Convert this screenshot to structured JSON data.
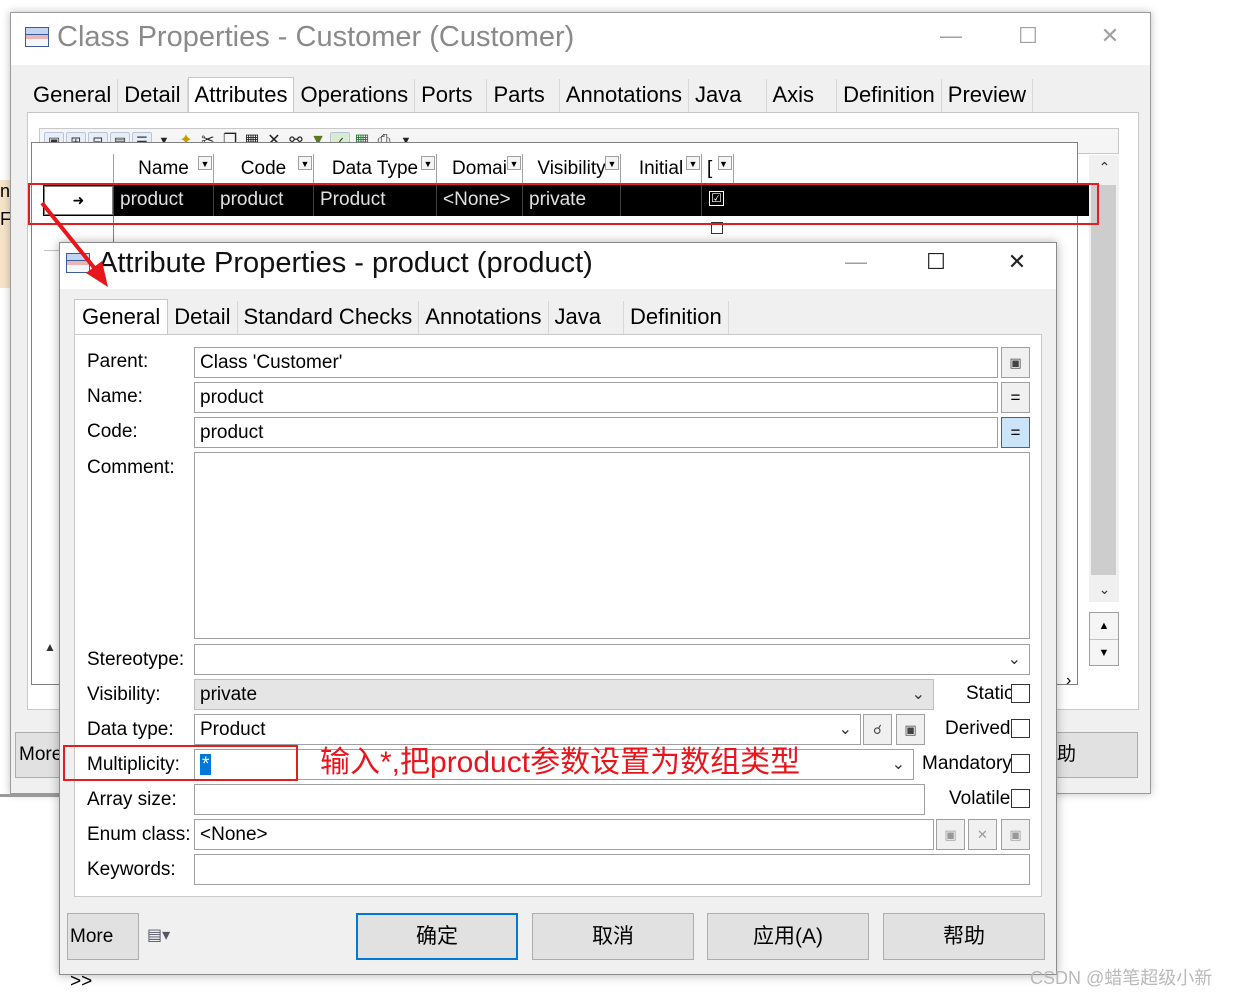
{
  "class_window": {
    "title": "Class Properties - Customer (Customer)",
    "tabs": [
      "General",
      "Detail",
      "Attributes",
      "Operations",
      "Ports",
      "Parts",
      "Annotations",
      "Java",
      "Axis",
      "Definition",
      "Preview"
    ],
    "active_tab": "Attributes",
    "grid": {
      "columns": [
        "Name",
        "Code",
        "Data Type",
        "Domai",
        "Visibility",
        "Initial",
        "["
      ],
      "row": {
        "marker": "➜",
        "name": "product",
        "code": "product",
        "data_type": "Product",
        "domain": "<None>",
        "visibility": "private",
        "initial": "",
        "checked": "☑"
      }
    },
    "more_button": "More",
    "help_button": "助"
  },
  "left_fragment": {
    "text1": "ne",
    "text2": "F"
  },
  "attr_dialog": {
    "title": "Attribute Properties - product (product)",
    "tabs": [
      "General",
      "Detail",
      "Standard Checks",
      "Annotations",
      "Java",
      "Definition"
    ],
    "active_tab": "General",
    "fields": {
      "parent_label": "Parent:",
      "parent_value": "Class 'Customer'",
      "name_label": "Name:",
      "name_value": "product",
      "code_label": "Code:",
      "code_value": "product",
      "comment_label": "Comment:",
      "comment_value": "",
      "stereotype_label": "Stereotype:",
      "stereotype_value": "",
      "visibility_label": "Visibility:",
      "visibility_value": "private",
      "datatype_label": "Data type:",
      "datatype_value": "Product",
      "multiplicity_label": "Multiplicity:",
      "multiplicity_value": "*",
      "arraysize_label": "Array size:",
      "arraysize_value": "",
      "enumclass_label": "Enum class:",
      "enumclass_value": "<None>",
      "keywords_label": "Keywords:",
      "keywords_value": ""
    },
    "checks": {
      "static": "Static",
      "derived": "Derived",
      "mandatory": "Mandatory",
      "volatile": "Volatile"
    },
    "buttons": {
      "more": "More >>",
      "ok": "确定",
      "cancel": "取消",
      "apply": "应用(A)",
      "help": "帮助"
    }
  },
  "annotation": "输入*,把product参数设置为数组类型",
  "watermark": "CSDN @蜡笔超级小新",
  "colors": {
    "annotation_red": "#e02020",
    "selection_blue": "#0078d7",
    "row_black": "#000000"
  }
}
